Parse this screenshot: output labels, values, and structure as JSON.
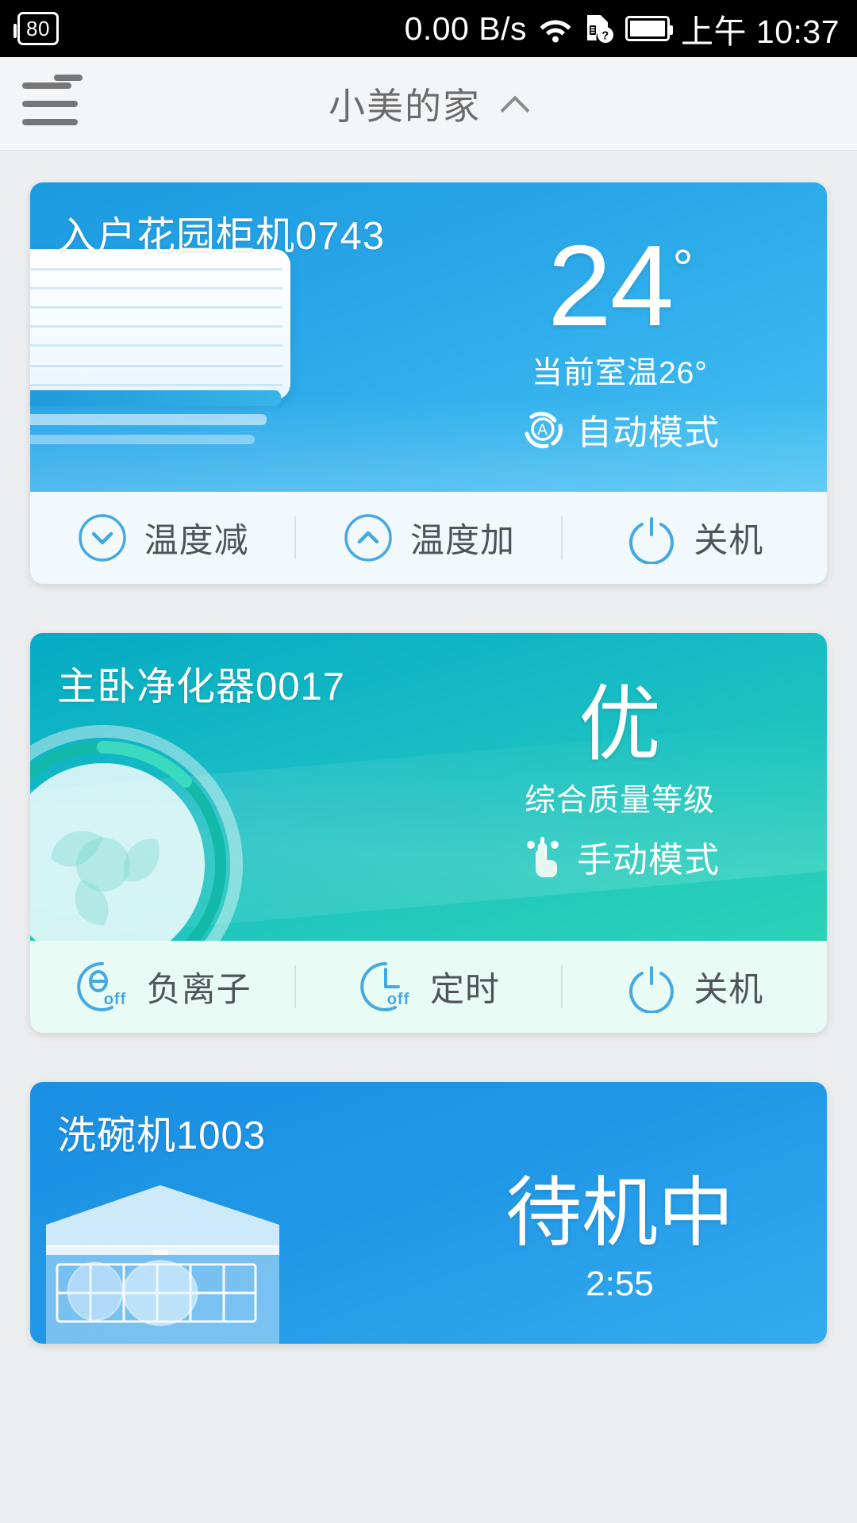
{
  "status_bar": {
    "battery_percent": "80",
    "network_speed": "0.00 B/s",
    "wifi_icon": "wifi-icon",
    "sim_icon": "sim-unknown-icon",
    "battery_icon": "battery-icon",
    "clock": "上午 10:37"
  },
  "app_bar": {
    "menu_icon": "hamburger-menu-icon",
    "notification_badge": "",
    "title": "小美的家",
    "chevron_icon": "chevron-up-icon"
  },
  "cards": [
    {
      "id": "air-conditioner",
      "title": "入户花园柜机0743",
      "primary_value": "24",
      "primary_unit": "°",
      "sub_line": "当前室温26°",
      "mode_icon": "auto-mode-icon",
      "mode_label": "自动模式",
      "accent": "#1c9ae0",
      "controls": [
        {
          "icon": "chevron-down-circle-icon",
          "label": "温度减"
        },
        {
          "icon": "chevron-up-circle-icon",
          "label": "温度加"
        },
        {
          "icon": "power-icon",
          "label": "关机"
        }
      ]
    },
    {
      "id": "air-purifier",
      "title": "主卧净化器0017",
      "primary_value": "优",
      "sub_line": "综合质量等级",
      "mode_icon": "manual-hand-icon",
      "mode_label": "手动模式",
      "accent": "#05aac4",
      "controls": [
        {
          "icon": "anion-off-icon",
          "label": "负离子"
        },
        {
          "icon": "timer-off-icon",
          "label": "定时"
        },
        {
          "icon": "power-icon",
          "label": "关机"
        }
      ]
    },
    {
      "id": "dishwasher",
      "title": "洗碗机1003",
      "primary_value": "待机中",
      "sub_line": "2:55",
      "accent": "#1b8fe2",
      "controls": []
    }
  ],
  "colors": {
    "badge_red": "#ee4055",
    "page_bg": "#eceeef",
    "appbar_bg": "#f4f5f6",
    "icon_blue": "#46a8e0",
    "control_text": "#4f5458"
  }
}
